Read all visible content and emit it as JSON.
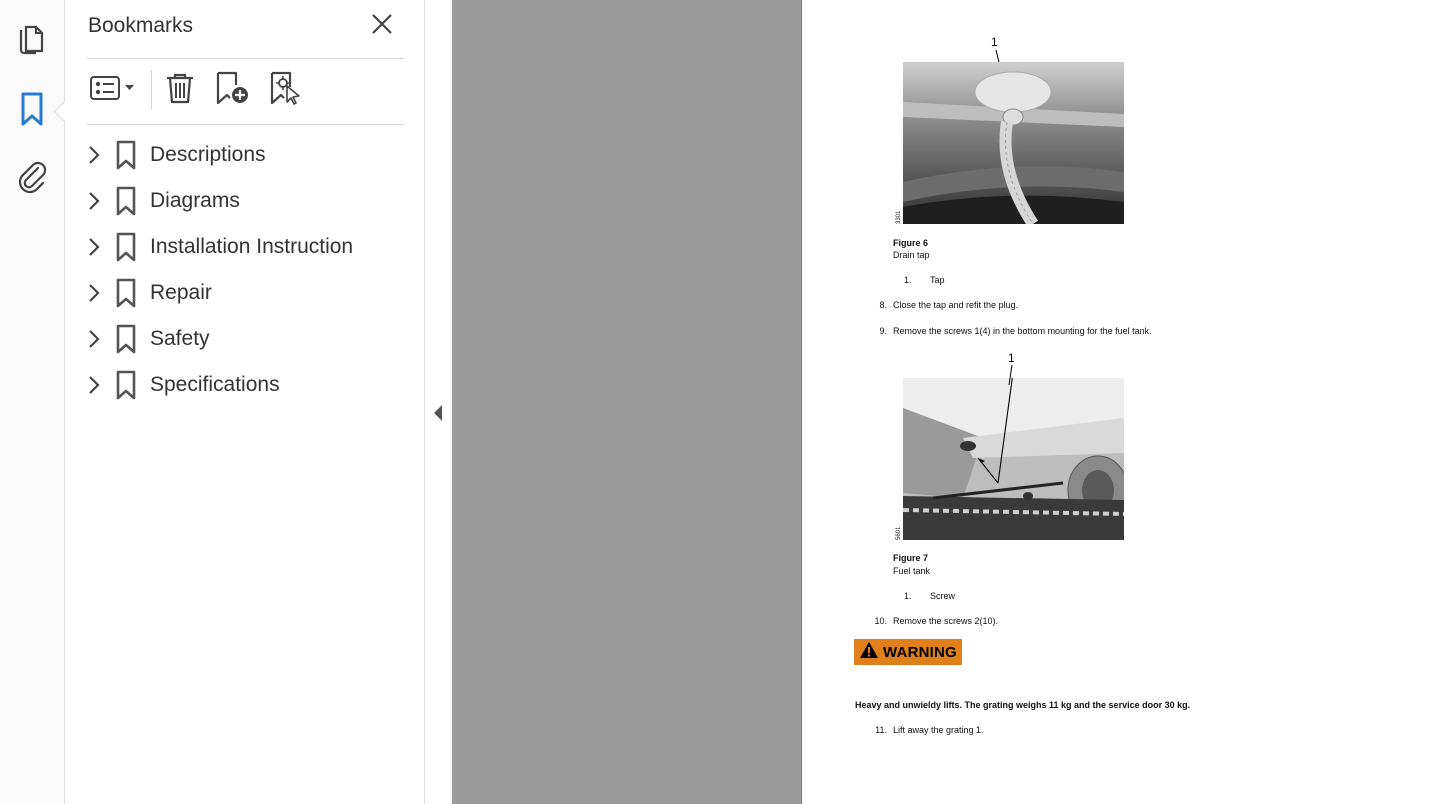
{
  "sidebar": {
    "active": "bookmarks",
    "icons": [
      "pages-icon",
      "bookmark-icon",
      "attachment-icon"
    ],
    "accent_color": "#2b7bd1"
  },
  "bookmarks_panel": {
    "title": "Bookmarks",
    "items": [
      {
        "label": "Descriptions"
      },
      {
        "label": "Diagrams"
      },
      {
        "label": "Installation Instruction"
      },
      {
        "label": "Repair"
      },
      {
        "label": "Safety"
      },
      {
        "label": "Specifications"
      }
    ]
  },
  "document": {
    "figure6": {
      "callout": "1",
      "side_code": "3301",
      "title": "Figure 6",
      "subtitle": "Drain tap",
      "legend": [
        {
          "num": "1.",
          "text": "Tap"
        }
      ]
    },
    "steps_a": [
      {
        "num": "8.",
        "text": "Close the tap and refit the plug."
      },
      {
        "num": "9.",
        "text": "Remove the screws 1(4) in the bottom mounting for the fuel tank."
      }
    ],
    "figure7": {
      "callout": "1",
      "side_code": "5601",
      "title": "Figure 7",
      "subtitle": "Fuel tank",
      "legend": [
        {
          "num": "1.",
          "text": "Screw"
        }
      ]
    },
    "steps_b": [
      {
        "num": "10.",
        "text": "Remove the screws 2(10)."
      }
    ],
    "warning": {
      "label": "WARNING",
      "color": "#e0801a"
    },
    "warning_text": "Heavy and unwieldy lifts. The grating weighs 11 kg and the service door 30 kg.",
    "steps_c": [
      {
        "num": "11.",
        "text": "Lift away the grating 1."
      }
    ]
  }
}
